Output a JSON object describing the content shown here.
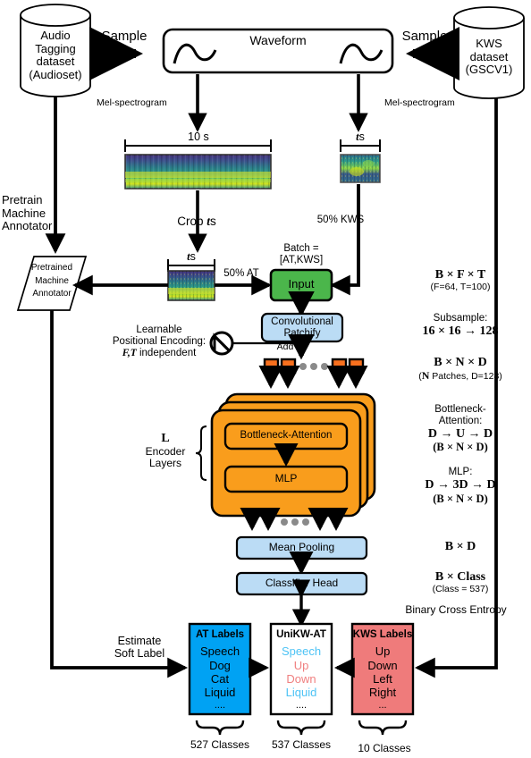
{
  "datasets": {
    "left": {
      "lines": [
        "Audio",
        "Tagging",
        "dataset",
        "(Audioset)"
      ]
    },
    "right": {
      "lines": [
        "KWS",
        "dataset",
        "(GSCV1)"
      ]
    }
  },
  "arrows": {
    "sample_left": "Sample",
    "sample_right": "Sample",
    "mel_left": "Mel-spectrogram",
    "mel_right": "Mel-spectrogram",
    "crop": "Crop",
    "crop_var": "t",
    "crop_unit": "s",
    "pct_at": "50% AT",
    "pct_kws": "50% KWS",
    "pretrain": [
      "Pretrain",
      "Machine",
      "Annotator"
    ],
    "estimate": [
      "Estimate",
      "Soft Label"
    ],
    "add": "Add"
  },
  "blocks": {
    "waveform": "Waveform",
    "annotator": [
      "Pretrained",
      "Machine",
      "Annotator"
    ],
    "input": "Input",
    "batch_caption": [
      "Batch =",
      "[AT,KWS]"
    ],
    "patchify": [
      "Convolutional",
      "Patchify"
    ],
    "attention": "Bottleneck-Attention",
    "mlp": "MLP",
    "meanpool": "Mean Pooling",
    "classifier": "Classifier Head"
  },
  "spectrograms": {
    "long_duration": "10 s",
    "short_duration_var": "t",
    "short_duration_unit": "s",
    "crop_duration_var": "t",
    "crop_duration_unit": "s"
  },
  "pos_enc": {
    "line1": "Learnable",
    "line2": "Positional Encoding:",
    "line3_vars": "F,T",
    "line3_rest": " independent"
  },
  "encoder": {
    "count_symbol": "L",
    "line2": "Encoder",
    "line3": "Layers"
  },
  "annotations": {
    "bft": "B × F × T",
    "bft_sub": "(F=64, T=100)",
    "subsample_label": "Subsample:",
    "subsample_value": "16 × 16 → 128",
    "bnd": "B × N × D",
    "bnd_sub_pre": "(",
    "bnd_sub_var": "N",
    "bnd_sub_post": " Patches, D=128)",
    "bottleneck_l1": "Bottleneck-",
    "bottleneck_l2": "Attention:",
    "bottleneck_l3": "D → U → D",
    "bottleneck_l4": "(B × N × D)",
    "mlp_l1": "MLP:",
    "mlp_l2": "D → 3D → D",
    "mlp_l3": "(B × N × D)",
    "bd": "B × D",
    "bclass": "B × Class",
    "bclass_sub": "(Class = 537)",
    "loss": "Binary Cross Entropy"
  },
  "label_boxes": [
    {
      "title": "AT Labels",
      "title_color": "#000000",
      "fill": "#00a2f3",
      "items": [
        {
          "text": "Speech",
          "color": "#000000"
        },
        {
          "text": "Dog",
          "color": "#000000"
        },
        {
          "text": "Cat",
          "color": "#000000"
        },
        {
          "text": "Liquid",
          "color": "#000000"
        },
        {
          "text": "....",
          "color": "#000000"
        }
      ],
      "brace_label": "527 Classes"
    },
    {
      "title": "UniKW-AT",
      "title_color": "#000000",
      "fill": "#ffffff",
      "items": [
        {
          "text": "Speech",
          "color": "#4dc3f5"
        },
        {
          "text": "Up",
          "color": "#f08080"
        },
        {
          "text": "Down",
          "color": "#f08080"
        },
        {
          "text": "Liquid",
          "color": "#4dc3f5"
        },
        {
          "text": "....",
          "color": "#000000"
        }
      ],
      "brace_label": "537 Classes"
    },
    {
      "title": "KWS Labels",
      "title_color": "#000000",
      "fill": "#ef7b7b",
      "items": [
        {
          "text": "Up",
          "color": "#000000"
        },
        {
          "text": "Down",
          "color": "#000000"
        },
        {
          "text": "Left",
          "color": "#000000"
        },
        {
          "text": "Right",
          "color": "#000000"
        },
        {
          "text": "...",
          "color": "#000000"
        }
      ],
      "brace_label": "10 Classes"
    }
  ],
  "colors": {
    "green": "#4bb64b",
    "orange": "#f99d1c",
    "patch_orange": "#f8701e",
    "lightblue": "#bbdcf5",
    "at_blue": "#00a2f3",
    "kws_red": "#ef7b7b",
    "line": "#000000"
  }
}
